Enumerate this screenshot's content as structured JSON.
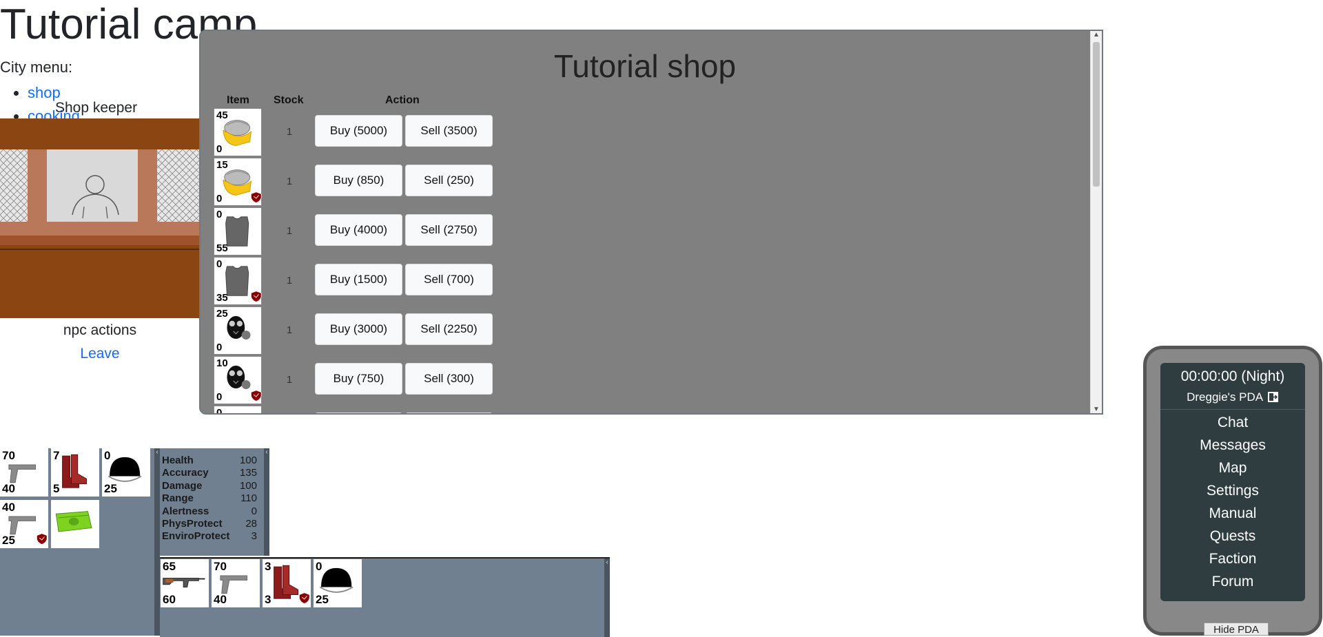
{
  "page": {
    "title": "Tutorial camp"
  },
  "city_menu": {
    "label": "City menu:",
    "items": [
      "shop",
      "cooking"
    ]
  },
  "npc": {
    "name": "Shop keeper",
    "actions_label": "npc actions",
    "leave_label": "Leave"
  },
  "shop": {
    "title": "Tutorial shop",
    "headers": {
      "item": "Item",
      "stock": "Stock",
      "action": "Action"
    },
    "rows": [
      {
        "item_icon": "hazmat-suit-icon",
        "top": "45",
        "bottom": "0",
        "damaged": false,
        "stock": "1",
        "buy": "Buy (5000)",
        "sell": "Sell (3500)"
      },
      {
        "item_icon": "hazmat-suit-icon",
        "top": "15",
        "bottom": "0",
        "damaged": true,
        "stock": "1",
        "buy": "Buy (850)",
        "sell": "Sell (250)"
      },
      {
        "item_icon": "armor-vest-icon",
        "top": "0",
        "bottom": "55",
        "damaged": false,
        "stock": "1",
        "buy": "Buy (4000)",
        "sell": "Sell (2750)"
      },
      {
        "item_icon": "armor-vest-icon",
        "top": "0",
        "bottom": "35",
        "damaged": true,
        "stock": "1",
        "buy": "Buy (1500)",
        "sell": "Sell (700)"
      },
      {
        "item_icon": "gas-mask-icon",
        "top": "25",
        "bottom": "0",
        "damaged": false,
        "stock": "1",
        "buy": "Buy (3000)",
        "sell": "Sell (2250)"
      },
      {
        "item_icon": "gas-mask-icon",
        "top": "10",
        "bottom": "0",
        "damaged": true,
        "stock": "1",
        "buy": "Buy (750)",
        "sell": "Sell (300)"
      },
      {
        "item_icon": "helmet-icon",
        "top": "0",
        "bottom": "",
        "damaged": false,
        "stock": "",
        "buy": "",
        "sell": ""
      }
    ]
  },
  "inventory": {
    "items": [
      {
        "icon": "pistol-icon",
        "top": "70",
        "bottom": "40",
        "damaged": false
      },
      {
        "icon": "boots-icon",
        "top": "7",
        "bottom": "5",
        "damaged": false
      },
      {
        "icon": "helmet-icon",
        "top": "0",
        "bottom": "25",
        "damaged": false
      },
      {
        "icon": "pistol-icon",
        "top": "40",
        "bottom": "25",
        "damaged": true
      },
      {
        "icon": "money-icon",
        "top": "",
        "bottom": "",
        "damaged": false
      }
    ]
  },
  "stats": [
    {
      "label": "Health",
      "value": "100"
    },
    {
      "label": "Accuracy",
      "value": "135"
    },
    {
      "label": "Damage",
      "value": "100"
    },
    {
      "label": "Range",
      "value": "110"
    },
    {
      "label": "Alertness",
      "value": "0"
    },
    {
      "label": "PhysProtect",
      "value": "28"
    },
    {
      "label": "EnviroProtect",
      "value": "3"
    }
  ],
  "equipped": {
    "items": [
      {
        "icon": "rifle-icon",
        "top": "65",
        "bottom": "60",
        "damaged": false
      },
      {
        "icon": "pistol-icon",
        "top": "70",
        "bottom": "40",
        "damaged": false
      },
      {
        "icon": "boots-icon",
        "top": "3",
        "bottom": "3",
        "damaged": true
      },
      {
        "icon": "helmet-icon",
        "top": "0",
        "bottom": "25",
        "damaged": false
      }
    ]
  },
  "pda": {
    "time": "00:00:00 (Night)",
    "owner": "Dreggie's PDA",
    "menu": [
      "Chat",
      "Messages",
      "Map",
      "Settings",
      "Manual",
      "Quests",
      "Faction",
      "Forum"
    ],
    "hide_label": "Hide PDA"
  },
  "colors": {
    "shop_bg": "#808080",
    "inventory_bg": "#708090",
    "pda_screen": "#2f3d40",
    "link": "#0d6efd"
  }
}
